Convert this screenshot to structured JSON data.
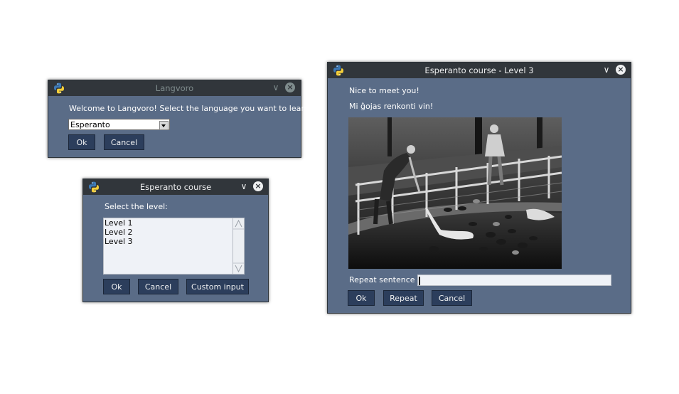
{
  "langvoro": {
    "title": "Langvoro",
    "prompt": "Welcome to Langvoro! Select the language you want to learn:",
    "selected_language": "Esperanto",
    "ok_label": "Ok",
    "cancel_label": "Cancel"
  },
  "course": {
    "title": "Esperanto course",
    "prompt": "Select the level:",
    "levels": [
      "Level 1",
      "Level 2",
      "Level 3"
    ],
    "ok_label": "Ok",
    "cancel_label": "Cancel",
    "custom_label": "Custom input"
  },
  "lesson": {
    "title": "Esperanto course - Level 3",
    "line1": "Nice to meet you!",
    "line2": "Mi ĝojas renkonti vin!",
    "repeat_label": "Repeat sentence",
    "repeat_value": "",
    "ok_label": "Ok",
    "repeat_button_label": "Repeat",
    "cancel_label": "Cancel"
  },
  "colors": {
    "window_bg": "#5a6c87",
    "titlebar_bg": "#31363b",
    "button_bg": "#2c3e5c"
  },
  "icons": {
    "app": "python-logo-icon",
    "minimize": "chevron-down-icon",
    "close": "close-icon"
  }
}
